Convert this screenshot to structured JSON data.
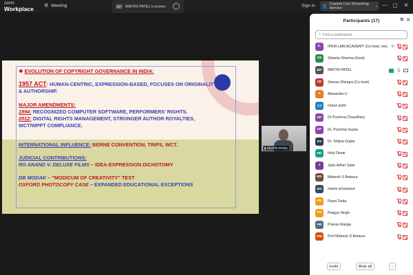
{
  "app": {
    "logo_top": "zoom",
    "logo_bottom": "Workplace"
  },
  "tabs": {
    "meeting": "Meeting",
    "screen_avatar": "MP",
    "screen": "MAITRI PATEL's screen",
    "more": "···"
  },
  "topbar": {
    "signin": "Sign in",
    "stream": "Custom Live Streaming Service",
    "chevron": "⌄",
    "minimize": "—",
    "maximize": "▢",
    "close": "✕"
  },
  "slide": {
    "bullet": "❖",
    "title": "EVOLUTION OF COPYRIGHT GOVERNANCE IN INDIA:",
    "act_year": "1957 ACT",
    "act_colon": ":",
    "act_text1": " HUMAN-CENTRIC, EXPRESSION-BASED, FOCUSES ON ORIGINALITY",
    "act_text2": "& AUTHORSHIP.",
    "amend_head": "MAJOR AMENDMENTS:",
    "a1994": "1994:",
    "a1994_text": " RECOGNIZED COMPUTER SOFTWARE, PERFORMERS' RIGHTS.",
    "a2012": "2012:",
    "a2012_text": " DIGITAL RIGHTS MANAGEMENT, STRONGER AUTHOR ROYALTIES,",
    "a2012_text2": "WCT/WPPT COMPLIANCE.",
    "intl_head": "INTERNATIONAL INFLUENCE:",
    "intl_text": " BERNE CONVENTION, TRIPS, WCT.",
    "jud_head": "JUDICIAL CONTRIBUTIONS:",
    "rg": "RG ANAND V. DELUXE FILMS",
    "rg_text": " – IDEA-EXPRESSION DICHOTOMY",
    "db": "DB MODAK",
    "db_text": " – \"MODICUM OF CREATIVITY\" TEST",
    "ox": "OXFORD PHOTOCOPY CASE",
    "ox_text": " – EXPANDED EDUCATIONAL EXCEPTIONS"
  },
  "video": {
    "name": "MAITRI PATEL"
  },
  "panel": {
    "title": "Participants (17)",
    "popout": "⧉",
    "close": "✕",
    "search_icon": "⌕",
    "search_placeholder": "Find a participant",
    "invite": "Invite",
    "mute_all": "Mute all",
    "more": "···",
    "participants": [
      {
        "initials": "IL",
        "name": "IPEM LAW ACADEMY (Co-host, me)",
        "color": "#8e44ad"
      },
      {
        "initials": "SS",
        "name": "Shweta Sharma (Host)",
        "color": "#2e8b57"
      },
      {
        "initials": "MP",
        "name": "MAITRI PATEL",
        "color": "#555555"
      },
      {
        "initials": "SD",
        "name": "Simran Dhingra (Co-host)",
        "color": "#c0392b"
      },
      {
        "initials": "A",
        "name": "Alexander.C",
        "color": "#e67e22"
      },
      {
        "initials": "CJ",
        "name": "charvi joshi",
        "color": "#2980b9"
      },
      {
        "initials": "DP",
        "name": "Dr Purnima Chaudhary",
        "color": "#8e44ad"
      },
      {
        "initials": "DP",
        "name": "Dr. Purnima Gupta",
        "color": "#8e44ad"
      },
      {
        "initials": "DS",
        "name": "Dr. Shipra Gupta",
        "color": "#2c3e50"
      },
      {
        "initials": "HD",
        "name": "Hely Desai",
        "color": "#16a085"
      },
      {
        "initials": "J",
        "name": "Jarin Alther Salvi",
        "color": "#7d3c98"
      },
      {
        "initials": "MS",
        "name": "Mahesh S Betasur",
        "color": "#6d4c41"
      },
      {
        "initials": "MS",
        "name": "mansi srivastava",
        "color": "#34495e"
      },
      {
        "initials": "PD",
        "name": "Payel Dutta",
        "color": "#f39c12"
      },
      {
        "initials": "PS",
        "name": "Pragya Singh",
        "color": "#f39c12"
      },
      {
        "initials": "PR",
        "name": "Pranav Ranga",
        "color": "#5d6d7e"
      },
      {
        "initials": "PM",
        "name": "Prof Mahesh S Betasur",
        "color": "#d35400"
      }
    ]
  }
}
